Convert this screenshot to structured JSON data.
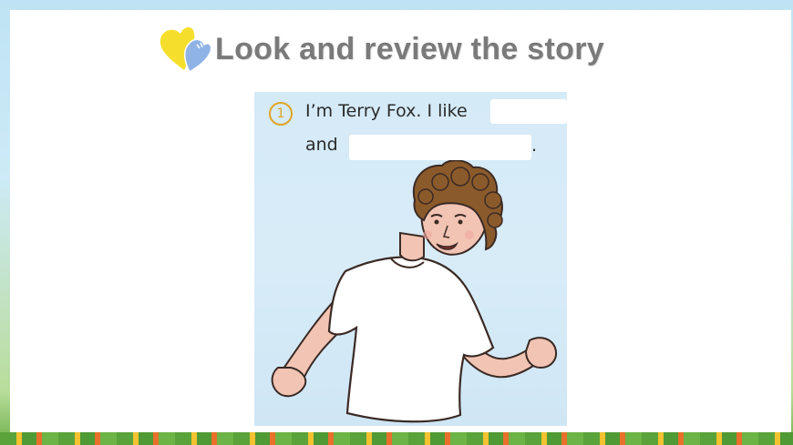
{
  "slide": {
    "title": "Look and review the story",
    "title_icon": "heart-icon"
  },
  "story_panel": {
    "number": "1",
    "line1": "I’m Terry Fox. I like",
    "line2": "and",
    "period": ".",
    "illustration": "running-man-illustration"
  },
  "colors": {
    "title": "#7a7a7a",
    "panel_background": "#d5eaf7",
    "number_accent": "#e0a528",
    "heart_yellow": "#f5df2c",
    "heart_blue": "#8fb3e4"
  }
}
